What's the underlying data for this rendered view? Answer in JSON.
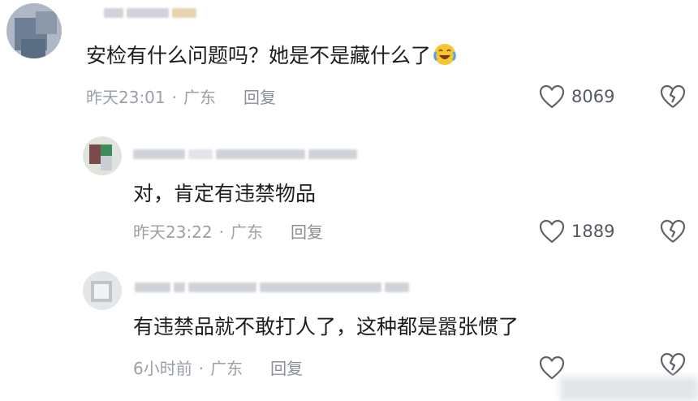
{
  "comments": [
    {
      "text": "安检有什么问题吗？她是不是藏什么了",
      "emoji": "crying-laughing-emoji",
      "time": "昨天23:01",
      "location": "广东",
      "reply_label": "回复",
      "likes": "8069"
    },
    {
      "text": "对，肯定有违禁物品",
      "time": "昨天23:22",
      "location": "广东",
      "reply_label": "回复",
      "likes": "1889"
    },
    {
      "text": "有违禁品就不敢打人了，这种都是嚣张惯了",
      "time": "6小时前",
      "location": "广东",
      "reply_label": "回复",
      "likes": ""
    }
  ],
  "separator": "·",
  "colors": {
    "meta_gray": "#9aa0a6",
    "icon_gray": "#5f6368"
  }
}
